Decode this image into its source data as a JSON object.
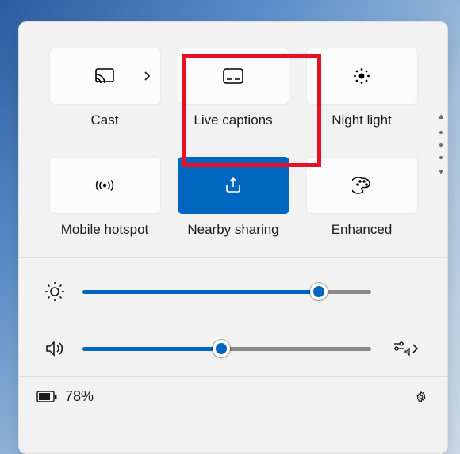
{
  "tiles": {
    "cast": {
      "label": "Cast"
    },
    "live_captions": {
      "label": "Live captions"
    },
    "night_light": {
      "label": "Night light"
    },
    "mobile_hotspot": {
      "label": "Mobile hotspot"
    },
    "nearby_sharing": {
      "label": "Nearby sharing"
    },
    "enhanced": {
      "label": "Enhanced"
    }
  },
  "sliders": {
    "brightness": {
      "percent": 82
    },
    "volume": {
      "percent": 48
    }
  },
  "status": {
    "battery_percent": "78%"
  }
}
